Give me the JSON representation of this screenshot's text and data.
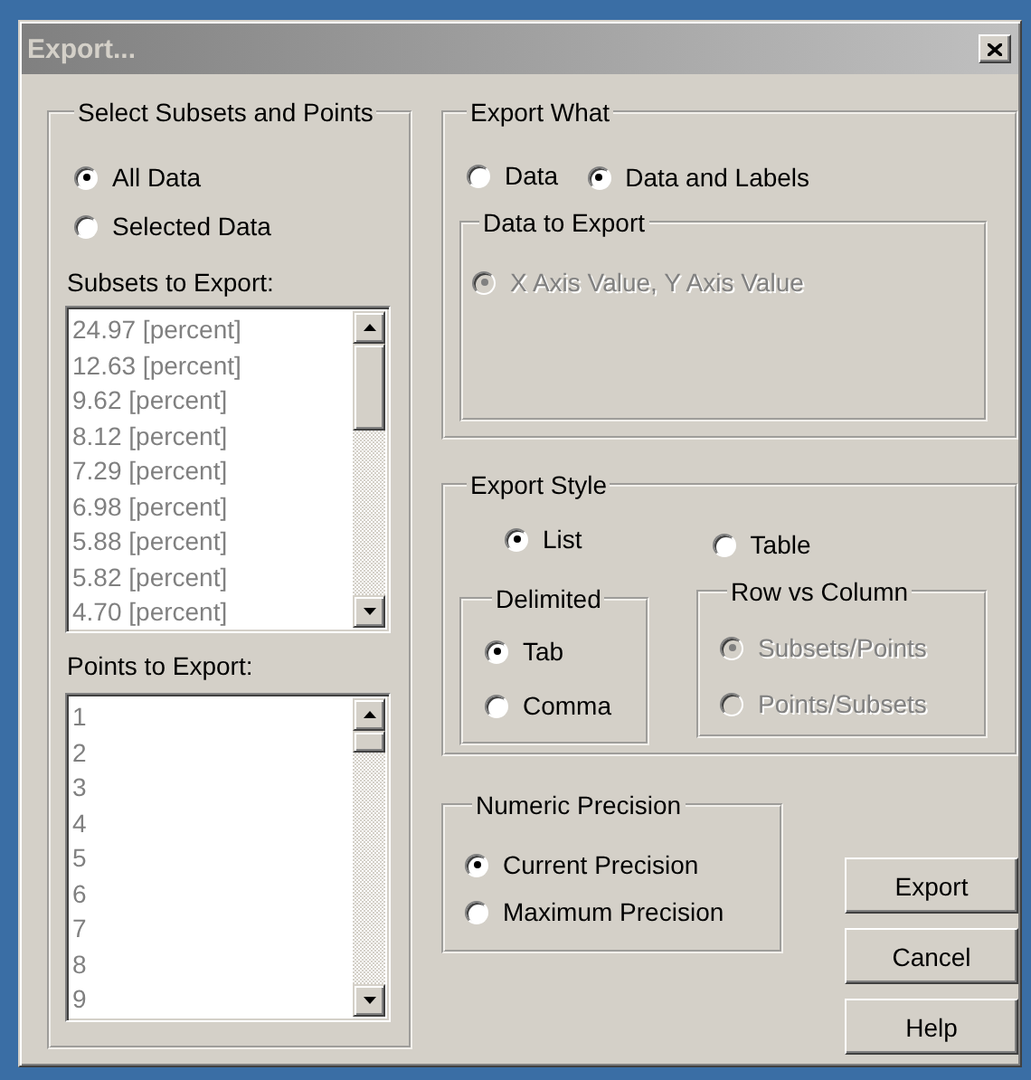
{
  "window": {
    "title": "Export..."
  },
  "select_group": {
    "title": "Select Subsets and Points",
    "options": [
      {
        "label": "All Data",
        "selected": true,
        "disabled": false
      },
      {
        "label": "Selected Data",
        "selected": false,
        "disabled": false
      }
    ],
    "subsets_label": "Subsets to Export:",
    "subsets": {
      "disabled": true,
      "items": [
        "24.97 [percent]",
        "12.63 [percent]",
        "9.62 [percent]",
        "8.12 [percent]",
        "7.29 [percent]",
        "6.98 [percent]",
        "5.88 [percent]",
        "5.82 [percent]",
        "4.70 [percent]"
      ]
    },
    "points_label": "Points to Export:",
    "points": {
      "disabled": true,
      "items": [
        "1",
        "2",
        "3",
        "4",
        "5",
        "6",
        "7",
        "8",
        "9"
      ]
    }
  },
  "export_what": {
    "title": "Export What",
    "options": [
      {
        "label": "Data",
        "selected": false,
        "disabled": false
      },
      {
        "label": "Data and Labels",
        "selected": true,
        "disabled": false
      }
    ],
    "data_to_export": {
      "title": "Data to Export",
      "options": [
        {
          "label": "X Axis Value, Y Axis Value",
          "selected": true,
          "disabled": true
        }
      ]
    }
  },
  "export_style": {
    "title": "Export Style",
    "options": [
      {
        "label": "List",
        "selected": true,
        "disabled": false
      },
      {
        "label": "Table",
        "selected": false,
        "disabled": false
      }
    ],
    "delimited": {
      "title": "Delimited",
      "options": [
        {
          "label": "Tab",
          "selected": true,
          "disabled": false
        },
        {
          "label": "Comma",
          "selected": false,
          "disabled": false
        }
      ]
    },
    "row_vs_column": {
      "title": "Row vs Column",
      "options": [
        {
          "label": "Subsets/Points",
          "selected": true,
          "disabled": true
        },
        {
          "label": "Points/Subsets",
          "selected": false,
          "disabled": true
        }
      ]
    }
  },
  "numeric_precision": {
    "title": "Numeric Precision",
    "options": [
      {
        "label": "Current Precision",
        "selected": true,
        "disabled": false
      },
      {
        "label": "Maximum Precision",
        "selected": false,
        "disabled": false
      }
    ]
  },
  "buttons": [
    "Export",
    "Cancel",
    "Help"
  ]
}
